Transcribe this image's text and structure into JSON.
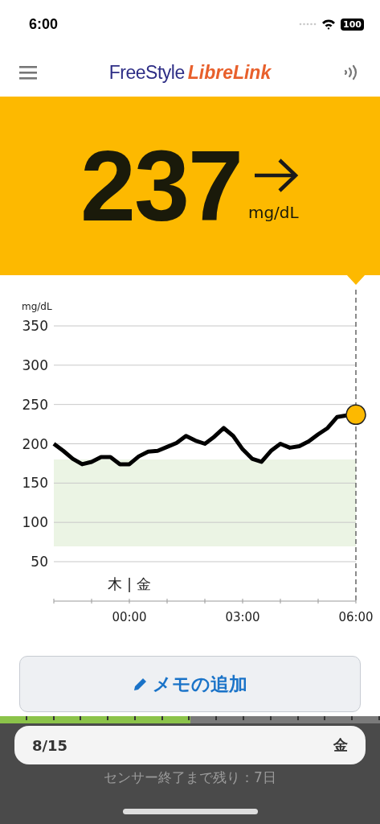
{
  "status_bar": {
    "time": "6:00",
    "battery": "100"
  },
  "header": {
    "logo_first": "FreeStyle",
    "logo_second": "LibreLink"
  },
  "reading": {
    "value": "237",
    "unit": "mg/dL"
  },
  "chart": {
    "unit_label": "mg/dL",
    "day_label": "木 | 金",
    "chart_data": {
      "type": "line",
      "x": [
        -2,
        -1.75,
        -1.5,
        -1.25,
        -1,
        -0.75,
        -0.5,
        -0.25,
        0,
        0.25,
        0.5,
        0.75,
        1,
        1.25,
        1.5,
        1.75,
        2,
        2.25,
        2.5,
        2.75,
        3,
        3.25,
        3.5,
        3.75,
        4,
        4.25,
        4.5,
        4.75,
        5,
        5.25,
        5.5,
        5.75,
        6
      ],
      "series": [
        {
          "color": "#000000",
          "values": [
            200,
            191,
            181,
            174,
            177,
            183,
            183,
            174,
            174,
            184,
            190,
            191,
            196,
            201,
            210,
            204,
            200,
            209,
            220,
            210,
            193,
            181,
            177,
            191,
            200,
            195,
            197,
            203,
            212,
            220,
            234,
            236,
            237
          ]
        }
      ],
      "xlim": [
        -2,
        6
      ],
      "ylim": [
        50,
        350
      ],
      "xticks": [
        {
          "value": 0,
          "label": "00:00"
        },
        {
          "value": 3,
          "label": "03:00"
        },
        {
          "value": 6,
          "label": "06:00"
        }
      ],
      "yticks": [
        50,
        100,
        150,
        200,
        250,
        300,
        350
      ],
      "grid": true
    }
  },
  "note_button": {
    "label": "メモの追加"
  },
  "sensor": {
    "level": 0.5,
    "date": "8/15",
    "weekday": "金",
    "remaining": "センサー終了まで残り：7日"
  }
}
